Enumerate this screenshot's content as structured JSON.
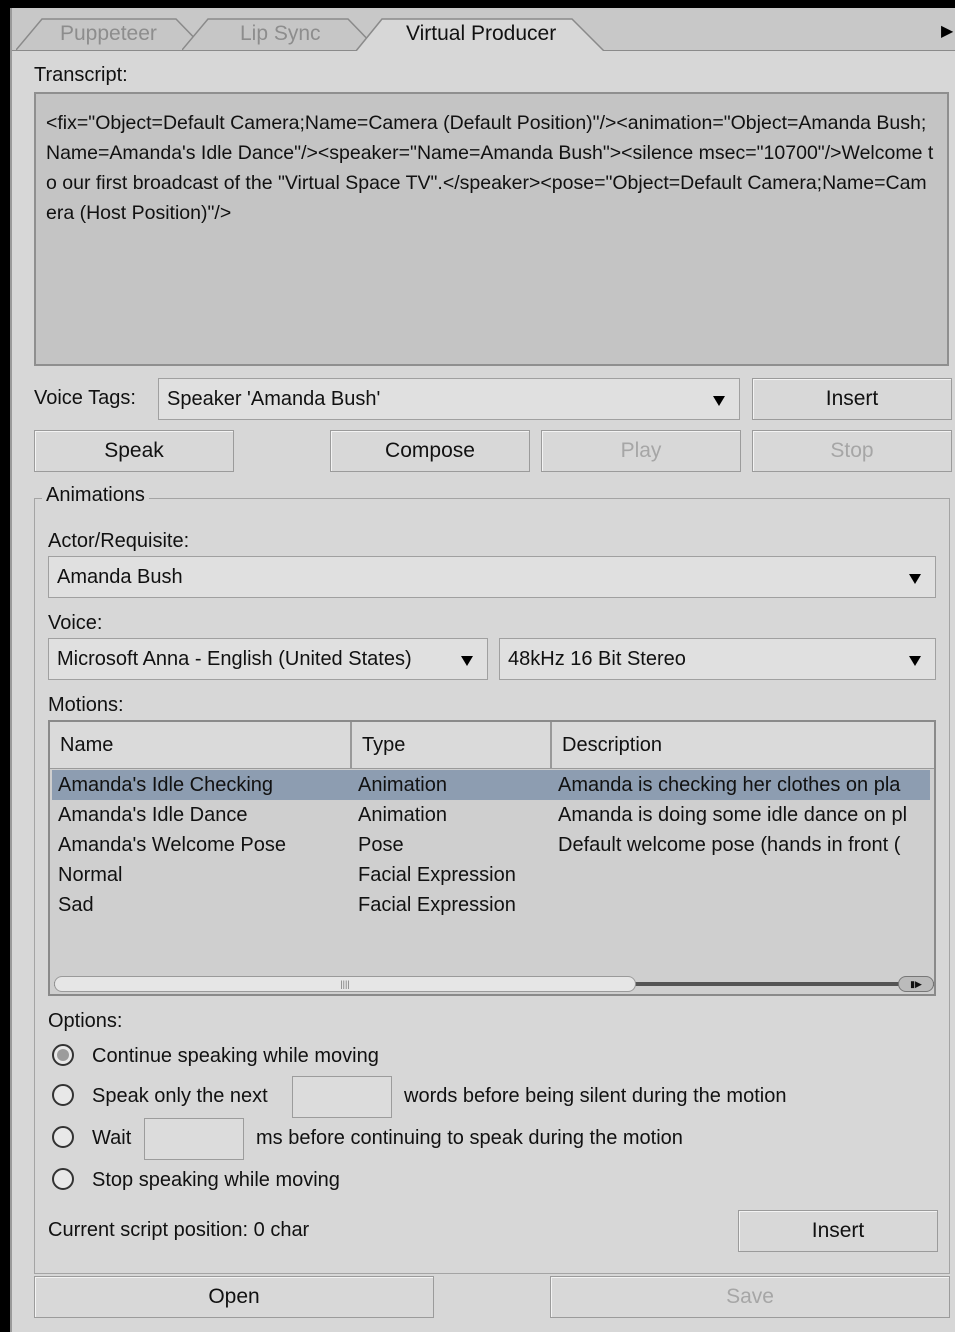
{
  "tabs": [
    {
      "label": "Puppeteer",
      "active": false
    },
    {
      "label": "Lip Sync",
      "active": false
    },
    {
      "label": "Virtual Producer",
      "active": true
    }
  ],
  "tab_menu_arrow": "▶",
  "transcript": {
    "label": "Transcript:",
    "text": "<fix=\"Object=Default Camera;Name=Camera (Default Position)\"/><animation=\"Object=Amanda Bush;Name=Amanda's Idle Dance\"/><speaker=\"Name=Amanda Bush\"><silence msec=\"10700\"/>Welcome to our first broadcast of the \"Virtual Space TV\".</speaker><pose=\"Object=Default Camera;Name=Camera (Host Position)\"/>"
  },
  "voice_tags": {
    "label": "Voice Tags:",
    "selected": "Speaker 'Amanda Bush'",
    "insert_label": "Insert"
  },
  "buttons": {
    "speak": "Speak",
    "compose": "Compose",
    "play": "Play",
    "stop": "Stop"
  },
  "animations": {
    "title": "Animations",
    "actor_label": "Actor/Requisite:",
    "actor_selected": "Amanda Bush",
    "voice_label": "Voice:",
    "voice_selected": "Microsoft Anna - English (United States)",
    "format_selected": "48kHz 16 Bit Stereo",
    "motions_label": "Motions:",
    "motions_columns": [
      "Name",
      "Type",
      "Description"
    ],
    "motions_rows": [
      {
        "name": "Amanda's Idle Checking",
        "type": "Animation",
        "description": "Amanda is checking her clothes on pla",
        "selected": true
      },
      {
        "name": "Amanda's Idle Dance",
        "type": "Animation",
        "description": "Amanda is doing some idle dance on pl",
        "selected": false
      },
      {
        "name": "Amanda's Welcome Pose",
        "type": "Pose",
        "description": "Default welcome pose (hands in front (",
        "selected": false
      },
      {
        "name": "Normal",
        "type": "Facial Expression",
        "description": "",
        "selected": false
      },
      {
        "name": "Sad",
        "type": "Facial Expression",
        "description": "",
        "selected": false
      }
    ],
    "options_label": "Options:",
    "option_continue": "Continue speaking while moving",
    "option_speak_next_a": "Speak only the next",
    "option_speak_next_b": "words before being silent during the motion",
    "option_wait_a": "Wait",
    "option_wait_b": "ms before continuing to speak during the motion",
    "option_stop": "Stop speaking while moving",
    "selected_option": "continue",
    "script_position": "Current script position:  0 char",
    "insert_label": "Insert"
  },
  "footer": {
    "open": "Open",
    "save": "Save"
  }
}
